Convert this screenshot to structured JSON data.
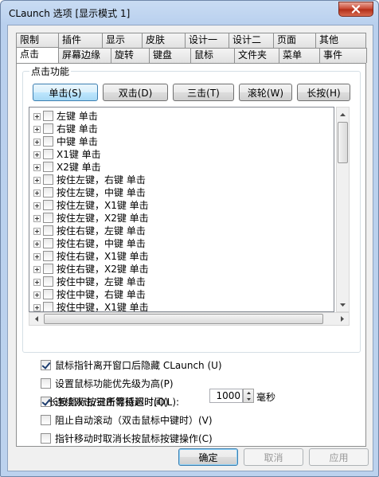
{
  "window": {
    "title": "CLaunch 选项 [显示模式 1]",
    "close_glyph": "✕"
  },
  "tabs": {
    "row1": [
      "限制",
      "插件",
      "显示",
      "皮肤",
      "设计一",
      "设计二",
      "页面",
      "其他"
    ],
    "row2": [
      "点击",
      "屏幕边缘",
      "旋转",
      "键盘",
      "鼠标",
      "文件夹",
      "菜单",
      "事件"
    ],
    "active": "点击"
  },
  "click_group": {
    "title": "点击功能",
    "buttons": [
      {
        "label": "单击(S)",
        "active": true
      },
      {
        "label": "双击(D)",
        "active": false
      },
      {
        "label": "三击(T)",
        "active": false
      },
      {
        "label": "滚轮(W)",
        "active": false
      },
      {
        "label": "长按(H)",
        "active": false
      }
    ],
    "tree_items": [
      "左键 单击",
      "右键 单击",
      "中键 单击",
      "X1键 单击",
      "X2键 单击",
      "按住左键，右键 单击",
      "按住左键，中键 单击",
      "按住左键，X1键 单击",
      "按住左键，X2键 单击",
      "按住右键，左键 单击",
      "按住右键，中键 单击",
      "按住右键，X1键 单击",
      "按住右键，X2键 单击",
      "按住中键，左键 单击",
      "按住中键，右键 单击",
      "按住中键，X1键 单击"
    ]
  },
  "options": [
    {
      "label": "鼠标指针离开窗口后隐藏 CLaunch (U)",
      "checked": true
    },
    {
      "label": "设置鼠标功能优先级为高(P)",
      "checked": false
    },
    {
      "label": "连续双击/三击等待超时(O)",
      "checked": true
    },
    {
      "label": "阻止自动滚动（双击鼠标中键时）(V)",
      "checked": false
    },
    {
      "label": "指针移动时取消长按鼠标按键操作(C)",
      "checked": false
    }
  ],
  "long_press": {
    "label": "长按鼠标按键所需延迟时间(L):",
    "value": "1000",
    "unit": "毫秒"
  },
  "dialog_buttons": {
    "ok": "确定",
    "cancel": "取消",
    "apply": "应用"
  }
}
